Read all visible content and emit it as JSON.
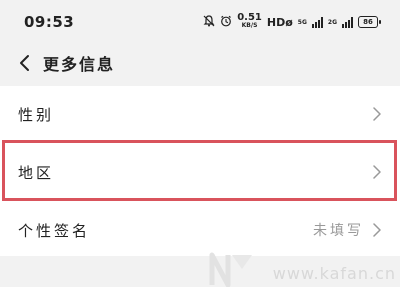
{
  "status_bar": {
    "time": "09:53",
    "net_speed_value": "0.51",
    "net_speed_unit": "KB/S",
    "hd_label": "HDø",
    "sim1_label": "5G",
    "sim2_label": "2G",
    "battery_level": "86"
  },
  "header": {
    "title": "更多信息"
  },
  "settings": [
    {
      "label": "性别",
      "value": ""
    },
    {
      "label": "地区",
      "value": ""
    },
    {
      "label": "个性签名",
      "value": "未填写"
    }
  ],
  "watermark": "www.kafan.cn",
  "highlight_color": "#d9535c"
}
